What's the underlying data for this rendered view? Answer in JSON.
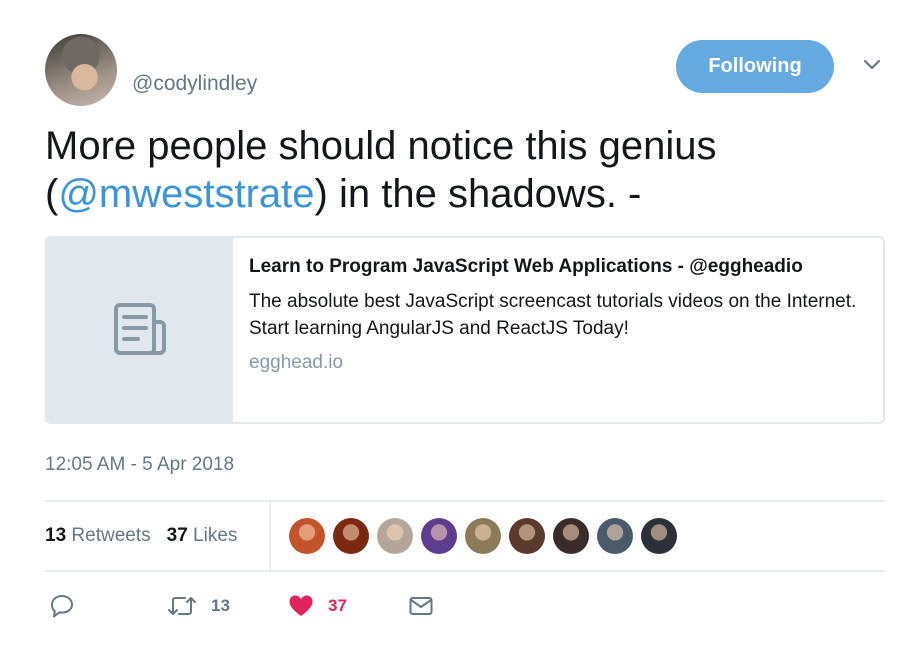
{
  "author": {
    "handle": "@codylindley",
    "avatar_icon": "user-avatar"
  },
  "follow_button": {
    "label": "Following",
    "color": "#64a9e0"
  },
  "menu_icon": "chevron-down-icon",
  "tweet": {
    "text_before": "More people should notice this genius (",
    "mention": "@mweststrate",
    "text_after": ") in the shadows. -",
    "mention_color": "#3b94d9"
  },
  "card": {
    "thumbnail_icon": "document-icon",
    "title": "Learn to Program JavaScript Web Applications - @eggheadio",
    "description": "The absolute best JavaScript screencast tutorials videos on the Internet. Start learning AngularJS and ReactJS Today!",
    "domain": "egghead.io"
  },
  "timestamp": "12:05 AM - 5 Apr 2018",
  "stats": {
    "retweets_count": "13",
    "retweets_label": "Retweets",
    "likes_count": "37",
    "likes_label": "Likes"
  },
  "likers": [
    {
      "color": "#c2532b"
    },
    {
      "color": "#7a2a10"
    },
    {
      "color": "#b3a79a"
    },
    {
      "color": "#5e3d8f"
    },
    {
      "color": "#8c7a5a"
    },
    {
      "color": "#5a3a2a"
    },
    {
      "color": "#3a2c2a"
    },
    {
      "color": "#4a5a6a"
    },
    {
      "color": "#2c3038"
    }
  ],
  "actions": {
    "reply_icon": "reply-icon",
    "retweet_icon": "retweet-icon",
    "retweet_count": "13",
    "like_icon": "heart-icon",
    "like_count": "37",
    "like_color": "#e0245e",
    "dm_icon": "envelope-icon"
  }
}
